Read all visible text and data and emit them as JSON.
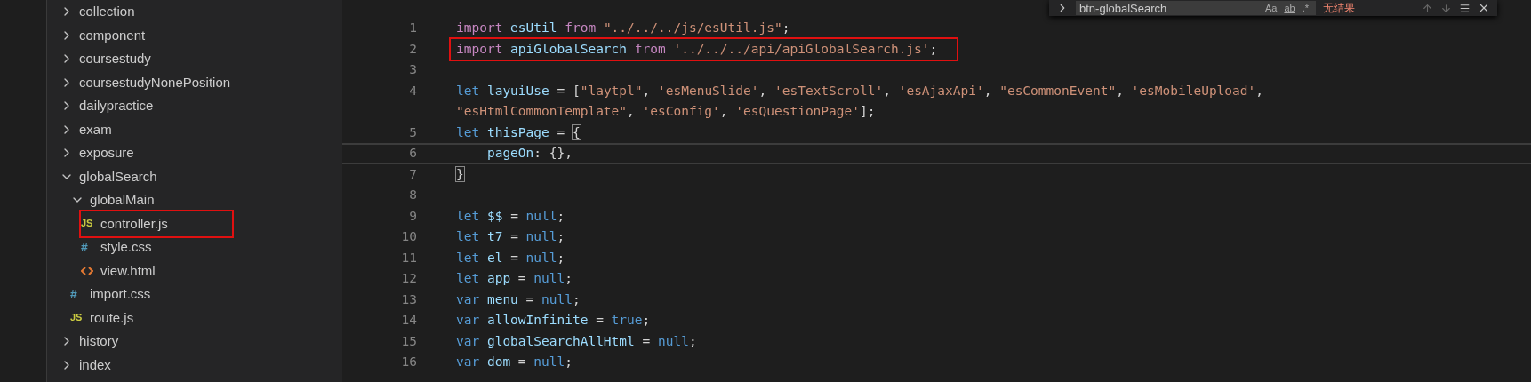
{
  "sidebar": {
    "tree": [
      {
        "label": "collection",
        "kind": "folder",
        "expanded": false
      },
      {
        "label": "component",
        "kind": "folder",
        "expanded": false
      },
      {
        "label": "coursestudy",
        "kind": "folder",
        "expanded": false
      },
      {
        "label": "coursestudyNonePosition",
        "kind": "folder",
        "expanded": false
      },
      {
        "label": "dailypractice",
        "kind": "folder",
        "expanded": false
      },
      {
        "label": "exam",
        "kind": "folder",
        "expanded": false
      },
      {
        "label": "exposure",
        "kind": "folder",
        "expanded": false
      },
      {
        "label": "globalSearch",
        "kind": "folder",
        "expanded": true,
        "children": [
          {
            "label": "globalMain",
            "kind": "folder",
            "expanded": true,
            "children": [
              {
                "label": "controller.js",
                "kind": "js",
                "icon": "JS",
                "annotated": true
              },
              {
                "label": "style.css",
                "kind": "css",
                "icon": "#",
                "annotated": false
              },
              {
                "label": "view.html",
                "kind": "html",
                "annotated": false
              }
            ]
          },
          {
            "label": "import.css",
            "kind": "css",
            "icon": "#",
            "annotated": false
          },
          {
            "label": "route.js",
            "kind": "js",
            "icon": "JS",
            "annotated": false
          }
        ]
      },
      {
        "label": "history",
        "kind": "folder",
        "expanded": false
      },
      {
        "label": "index",
        "kind": "folder",
        "expanded": false
      }
    ]
  },
  "editor": {
    "lines": [
      {
        "number": "1",
        "annotated": false,
        "current": false,
        "tokens": [
          {
            "kind": "kw",
            "text": "import "
          },
          {
            "kind": "id",
            "text": "esUtil "
          },
          {
            "kind": "kw",
            "text": "from "
          },
          {
            "kind": "str",
            "text": "\"../../../js/esUtil.js\""
          },
          {
            "kind": "plain",
            "text": ";"
          }
        ]
      },
      {
        "number": "2",
        "annotated": true,
        "current": false,
        "tokens": [
          {
            "kind": "kw",
            "text": "import "
          },
          {
            "kind": "id",
            "text": "apiGlobalSearch "
          },
          {
            "kind": "kw",
            "text": "from "
          },
          {
            "kind": "str",
            "text": "'../../../api/apiGlobalSearch.js'"
          },
          {
            "kind": "plain",
            "text": ";"
          }
        ]
      },
      {
        "number": "3",
        "annotated": false,
        "current": false
      },
      {
        "number": "4",
        "annotated": false,
        "current": false,
        "tokens": [
          {
            "kind": "decl",
            "text": "let "
          },
          {
            "kind": "id",
            "text": "layuiUse "
          },
          {
            "kind": "plain",
            "text": "= ["
          },
          {
            "kind": "str",
            "text": "\"laytpl\""
          },
          {
            "kind": "plain",
            "text": ", "
          },
          {
            "kind": "str",
            "text": "'esMenuSlide'"
          },
          {
            "kind": "plain",
            "text": ", "
          },
          {
            "kind": "str",
            "text": "'esTextScroll'"
          },
          {
            "kind": "plain",
            "text": ", "
          },
          {
            "kind": "str",
            "text": "'esAjaxApi'"
          },
          {
            "kind": "plain",
            "text": ", "
          },
          {
            "kind": "str",
            "text": "\"esCommonEvent\""
          },
          {
            "kind": "plain",
            "text": ", "
          },
          {
            "kind": "str",
            "text": "'esMobileUpload'"
          },
          {
            "kind": "plain",
            "text": ","
          },
          {
            "kind": "str",
            "text": "\"esHtmlCommonTemplate\"",
            "wrap_before": true
          },
          {
            "kind": "plain",
            "text": ", "
          },
          {
            "kind": "str",
            "text": "'esConfig'"
          },
          {
            "kind": "plain",
            "text": ", "
          },
          {
            "kind": "str",
            "text": "'esQuestionPage'"
          },
          {
            "kind": "plain",
            "text": "];"
          }
        ]
      },
      {
        "number": "5",
        "annotated": false,
        "current": false,
        "tokens": [
          {
            "kind": "decl",
            "text": "let "
          },
          {
            "kind": "id",
            "text": "thisPage "
          },
          {
            "kind": "plain",
            "text": "= "
          },
          {
            "kind": "brace",
            "text": "{"
          }
        ]
      },
      {
        "number": "6",
        "annotated": false,
        "current": true,
        "tokens": [
          {
            "kind": "id",
            "text": "    pageOn"
          },
          {
            "kind": "plain",
            "text": ": {},"
          }
        ]
      },
      {
        "number": "7",
        "annotated": false,
        "current": false,
        "tokens": [
          {
            "kind": "brace",
            "text": "}"
          }
        ]
      },
      {
        "number": "8",
        "annotated": false,
        "current": false
      },
      {
        "number": "9",
        "annotated": false,
        "current": false,
        "tokens": [
          {
            "kind": "decl",
            "text": "let "
          },
          {
            "kind": "id",
            "text": "$$ "
          },
          {
            "kind": "plain",
            "text": "= "
          },
          {
            "kind": "decl",
            "text": "null"
          },
          {
            "kind": "plain",
            "text": ";"
          }
        ]
      },
      {
        "number": "10",
        "annotated": false,
        "current": false,
        "tokens": [
          {
            "kind": "decl",
            "text": "let "
          },
          {
            "kind": "id",
            "text": "t7 "
          },
          {
            "kind": "plain",
            "text": "= "
          },
          {
            "kind": "decl",
            "text": "null"
          },
          {
            "kind": "plain",
            "text": ";"
          }
        ]
      },
      {
        "number": "11",
        "annotated": false,
        "current": false,
        "tokens": [
          {
            "kind": "decl",
            "text": "let "
          },
          {
            "kind": "id",
            "text": "el "
          },
          {
            "kind": "plain",
            "text": "= "
          },
          {
            "kind": "decl",
            "text": "null"
          },
          {
            "kind": "plain",
            "text": ";"
          }
        ]
      },
      {
        "number": "12",
        "annotated": false,
        "current": false,
        "tokens": [
          {
            "kind": "decl",
            "text": "let "
          },
          {
            "kind": "id",
            "text": "app "
          },
          {
            "kind": "plain",
            "text": "= "
          },
          {
            "kind": "decl",
            "text": "null"
          },
          {
            "kind": "plain",
            "text": ";"
          }
        ]
      },
      {
        "number": "13",
        "annotated": false,
        "current": false,
        "tokens": [
          {
            "kind": "decl",
            "text": "var "
          },
          {
            "kind": "id",
            "text": "menu "
          },
          {
            "kind": "plain",
            "text": "= "
          },
          {
            "kind": "decl",
            "text": "null"
          },
          {
            "kind": "plain",
            "text": ";"
          }
        ]
      },
      {
        "number": "14",
        "annotated": false,
        "current": false,
        "tokens": [
          {
            "kind": "decl",
            "text": "var "
          },
          {
            "kind": "id",
            "text": "allowInfinite "
          },
          {
            "kind": "plain",
            "text": "= "
          },
          {
            "kind": "decl",
            "text": "true"
          },
          {
            "kind": "plain",
            "text": ";"
          }
        ]
      },
      {
        "number": "15",
        "annotated": false,
        "current": false,
        "tokens": [
          {
            "kind": "decl",
            "text": "var "
          },
          {
            "kind": "id",
            "text": "globalSearchAllHtml "
          },
          {
            "kind": "plain",
            "text": "= "
          },
          {
            "kind": "decl",
            "text": "null"
          },
          {
            "kind": "plain",
            "text": ";"
          }
        ]
      },
      {
        "number": "16",
        "annotated": false,
        "current": false,
        "tokens": [
          {
            "kind": "decl",
            "text": "var "
          },
          {
            "kind": "id",
            "text": "dom "
          },
          {
            "kind": "plain",
            "text": "= "
          },
          {
            "kind": "decl",
            "text": "null"
          },
          {
            "kind": "plain",
            "text": ";"
          }
        ]
      }
    ]
  },
  "find_widget": {
    "query": "btn-globalSearch",
    "options": [
      {
        "label": "Aa",
        "underline": false
      },
      {
        "label": "ab",
        "underline": true
      },
      {
        "label": ".*",
        "underline": false
      }
    ],
    "result": "无结果"
  }
}
